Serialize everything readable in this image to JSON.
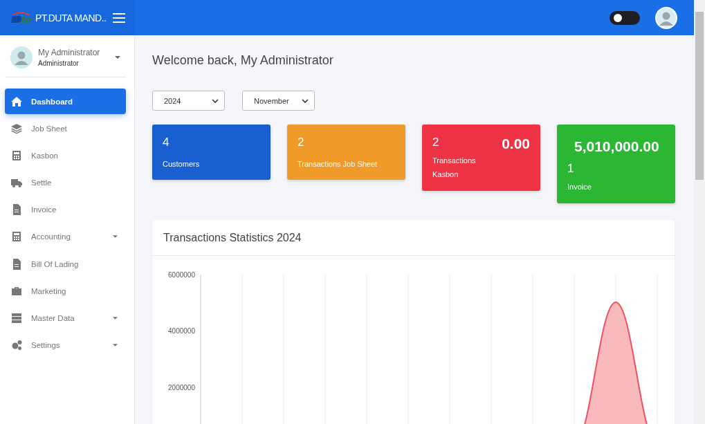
{
  "brand": {
    "name": "PT.DUTA MAND.."
  },
  "header": {
    "theme_toggle": {
      "on": false
    }
  },
  "user": {
    "name": "My Administrator",
    "role": "Administrator"
  },
  "sidebar": {
    "items": [
      {
        "label": "Dashboard",
        "selected": true,
        "has_submenu": false
      },
      {
        "label": "Job Sheet",
        "selected": false,
        "has_submenu": false
      },
      {
        "label": "Kasbon",
        "selected": false,
        "has_submenu": false
      },
      {
        "label": "Settle",
        "selected": false,
        "has_submenu": false
      },
      {
        "label": "Invoice",
        "selected": false,
        "has_submenu": false
      },
      {
        "label": "Accounting",
        "selected": false,
        "has_submenu": true
      },
      {
        "label": "Bill Of Lading",
        "selected": false,
        "has_submenu": false
      },
      {
        "label": "Marketing",
        "selected": false,
        "has_submenu": false
      },
      {
        "label": "Master Data",
        "selected": false,
        "has_submenu": true
      },
      {
        "label": "Settings",
        "selected": false,
        "has_submenu": true
      }
    ]
  },
  "page": {
    "greeting": "Welcome back, My Administrator"
  },
  "filters": [
    {
      "value": "2024"
    },
    {
      "value": "November"
    }
  ],
  "stat_cards": [
    {
      "kind": "count",
      "count": "4",
      "label": "Customers",
      "color": "#1a5fcf"
    },
    {
      "kind": "count",
      "count": "2",
      "label": "Transactions Job Sheet",
      "color": "#f09a2a"
    },
    {
      "kind": "amount-right",
      "count": "2",
      "amount": "0.00",
      "label": "Transactions Kasbon",
      "color": "#ee3344"
    },
    {
      "kind": "amount-top",
      "count": "1",
      "amount": "5,010,000.00",
      "label": "Invoice",
      "color": "#2bb734"
    }
  ],
  "stats": {
    "title": "Transactions Statistics 2024",
    "y_axis_labels": [
      "6000000",
      "4000000",
      "2000000"
    ]
  }
}
